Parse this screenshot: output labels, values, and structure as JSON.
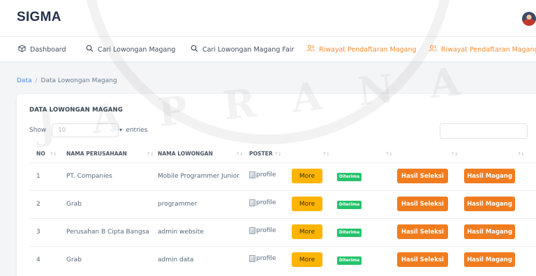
{
  "app": {
    "brand": "SIGMA"
  },
  "menu": [
    {
      "label": "Dashboard",
      "icon": "cube-icon"
    },
    {
      "label": "Cari Lowongan Magang",
      "icon": "search-icon"
    },
    {
      "label": "Cari Lowongan Magang Fair",
      "icon": "search-icon"
    },
    {
      "label": "Riwayat Pendaftaran Magang",
      "icon": "users-icon"
    },
    {
      "label": "Riwayat Pendaftaran Magang Fair",
      "icon": "users-icon"
    }
  ],
  "breadcrumb": {
    "root": "Data",
    "separator": "/",
    "current": "Data Lowongan Magang"
  },
  "table_card": {
    "title": "DATA LOWONGAN MAGANG",
    "show_label": "Show",
    "entries_value": "10",
    "entries_label": "entries",
    "columns": [
      "NO",
      "NAMA PERUSAHAAN",
      "NAMA LOWONGAN",
      "POSTER"
    ],
    "rows": [
      {
        "no": "1",
        "company": "PT. Companies",
        "position": "Mobile Programmer Junior",
        "poster_alt": "profile",
        "more": "More",
        "status": "Diterima",
        "seleksi": "Hasil Seleksi",
        "magang": "Hasil Magang"
      },
      {
        "no": "2",
        "company": "Grab",
        "position": "programmer",
        "poster_alt": "profile",
        "more": "More",
        "status": "Diterima",
        "seleksi": "Hasil Seleksi",
        "magang": "Hasil Magang"
      },
      {
        "no": "3",
        "company": "Perusahan B Cipta Bangsa",
        "position": "admin website",
        "poster_alt": "profile",
        "more": "More",
        "status": "Diterima",
        "seleksi": "Hasil Seleksi",
        "magang": "Hasil Magang"
      },
      {
        "no": "4",
        "company": "Grab",
        "position": "admin data",
        "poster_alt": "profile",
        "more": "More",
        "status": "Diterima",
        "seleksi": "Hasil Seleksi",
        "magang": "Hasil Magang"
      }
    ]
  },
  "watermark": "JAPRANA",
  "colors": {
    "accent_orange": "#f17c1f",
    "more_yellow": "#ffb400",
    "badge_green": "#25c26a",
    "link_blue": "#3d8ef8"
  }
}
